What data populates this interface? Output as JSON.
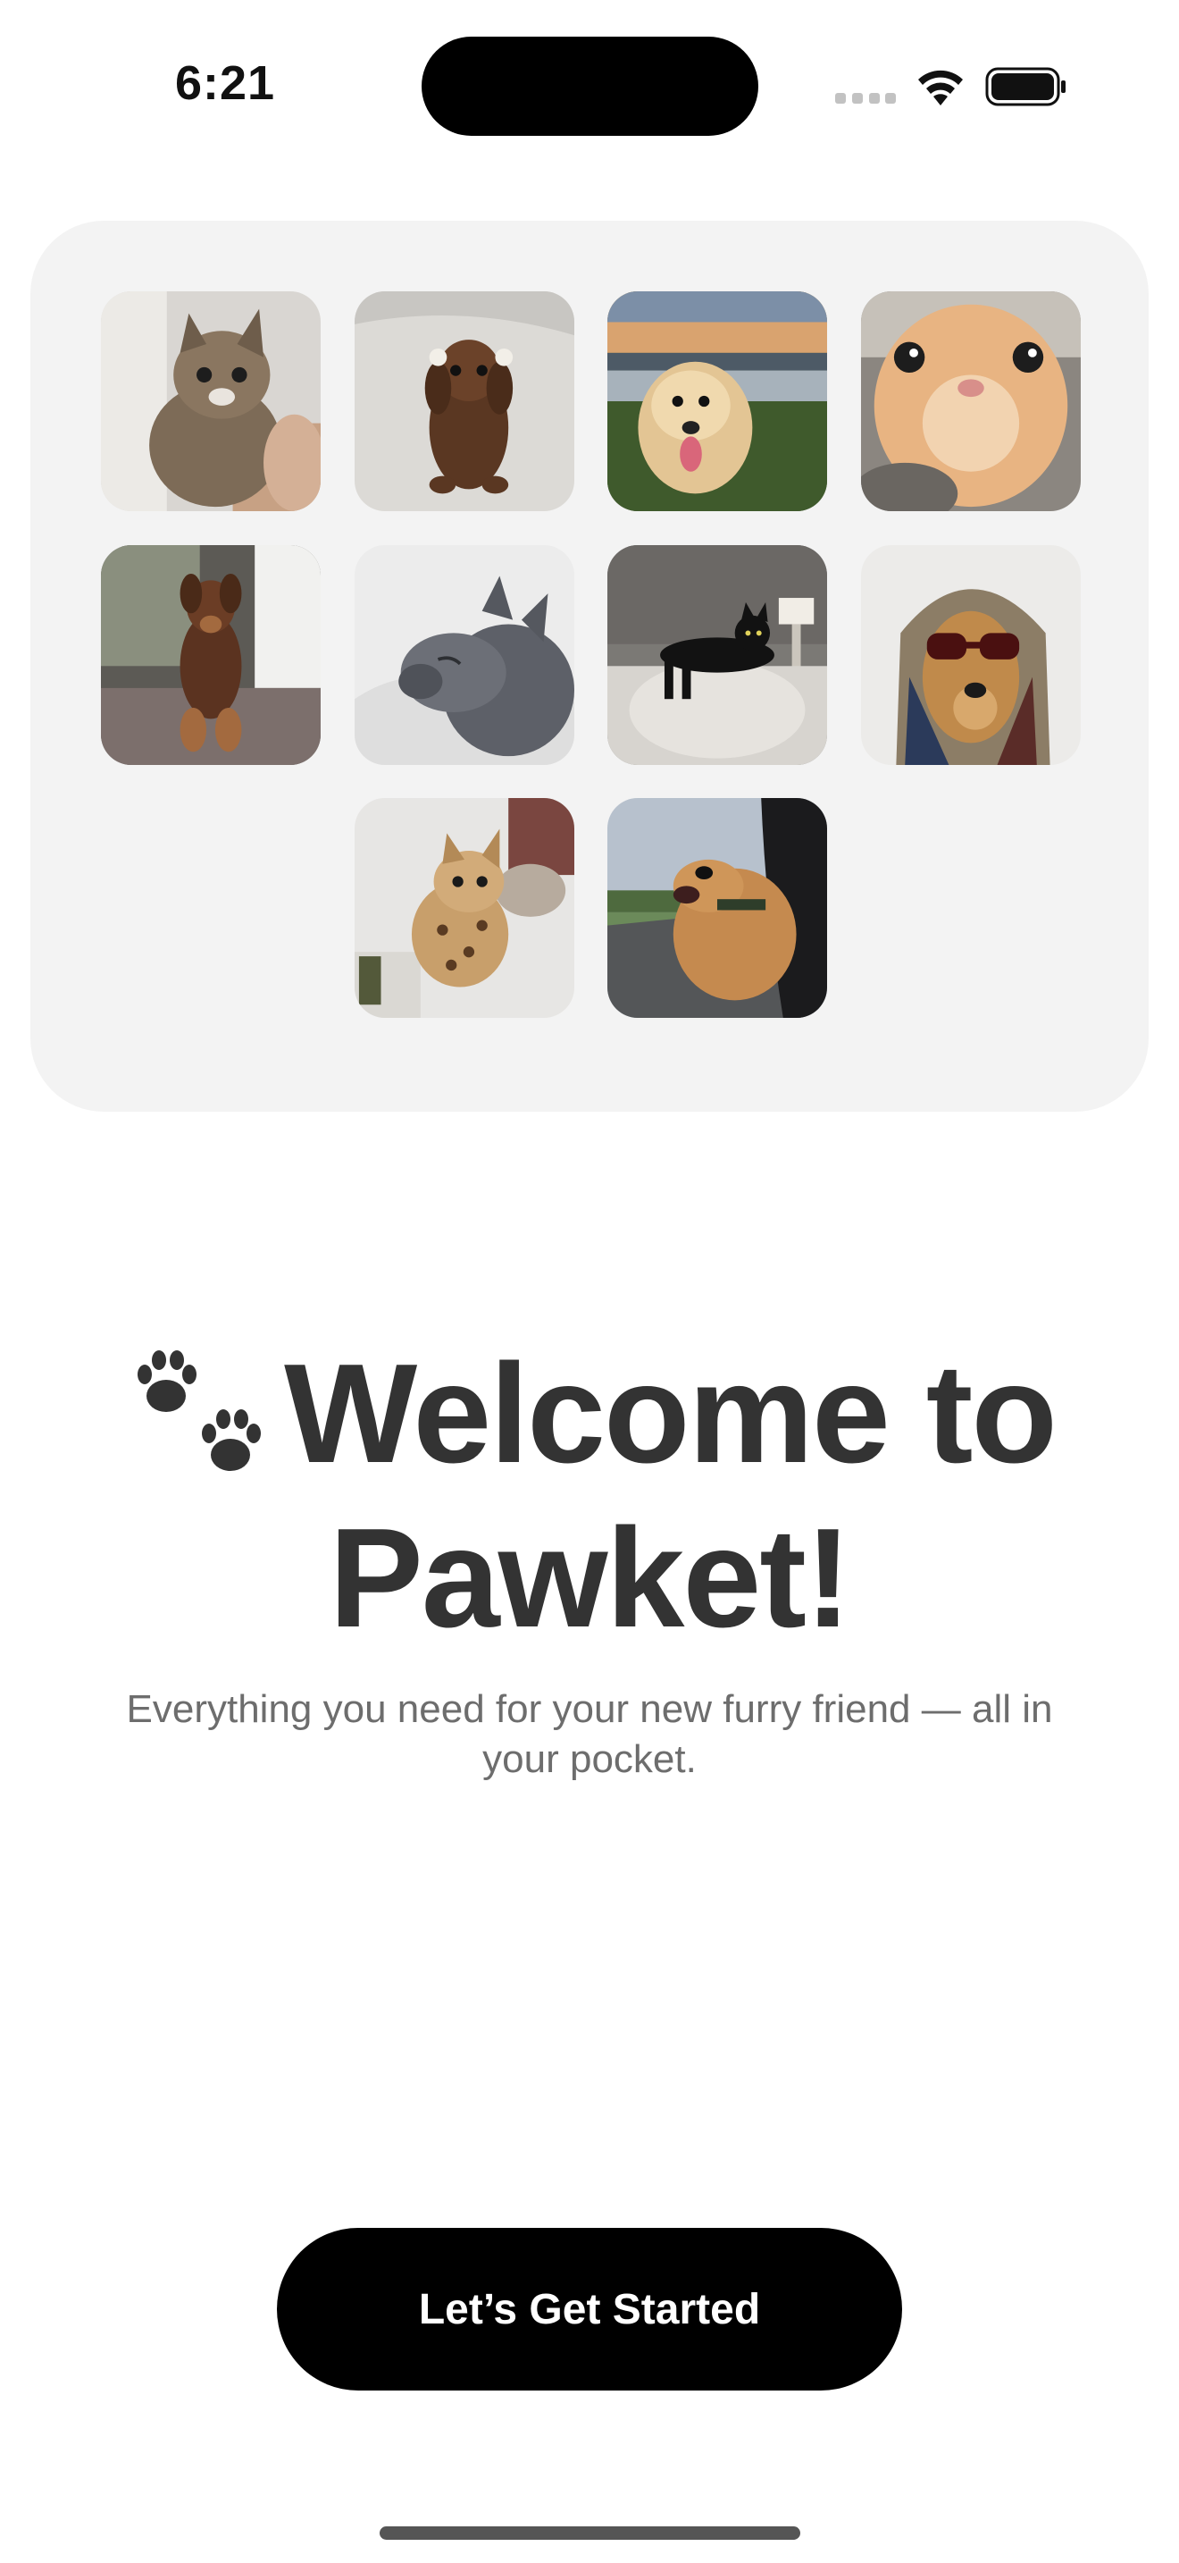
{
  "status_bar": {
    "time": "6:21",
    "icons": [
      "cellular-signal-icon",
      "wifi-icon",
      "battery-icon"
    ]
  },
  "gallery": {
    "photos": [
      {
        "name": "tabby-kitten-photo",
        "subject": "tabby kitten held in hand"
      },
      {
        "name": "dachshund-puppy-photo",
        "subject": "dachshund puppy with bows"
      },
      {
        "name": "golden-retriever-sunset-photo",
        "subject": "golden retriever at sunset"
      },
      {
        "name": "orange-cat-closeup-photo",
        "subject": "orange cat close-up"
      },
      {
        "name": "doberman-puppy-photo",
        "subject": "doberman puppy sitting"
      },
      {
        "name": "french-bulldog-photo",
        "subject": "french bulldog sleeping"
      },
      {
        "name": "black-cat-photo",
        "subject": "black cat on couch"
      },
      {
        "name": "dog-sunglasses-photo",
        "subject": "dog wearing scarf and sunglasses"
      },
      {
        "name": "bengal-kitten-photo",
        "subject": "bengal kitten"
      },
      {
        "name": "dog-car-window-photo",
        "subject": "dog out of car window"
      }
    ]
  },
  "welcome": {
    "headline_line1": "Welcome to",
    "headline_line2": "Pawket!",
    "subtitle": "Everything you need for your new furry friend — all in your pocket."
  },
  "cta": {
    "label": "Let’s Get Started"
  },
  "colors": {
    "background": "#ffffff",
    "card": "#f3f3f3",
    "headline": "#333333",
    "subtitle": "#6d6d6d",
    "button": "#000000",
    "button_text": "#ffffff"
  }
}
